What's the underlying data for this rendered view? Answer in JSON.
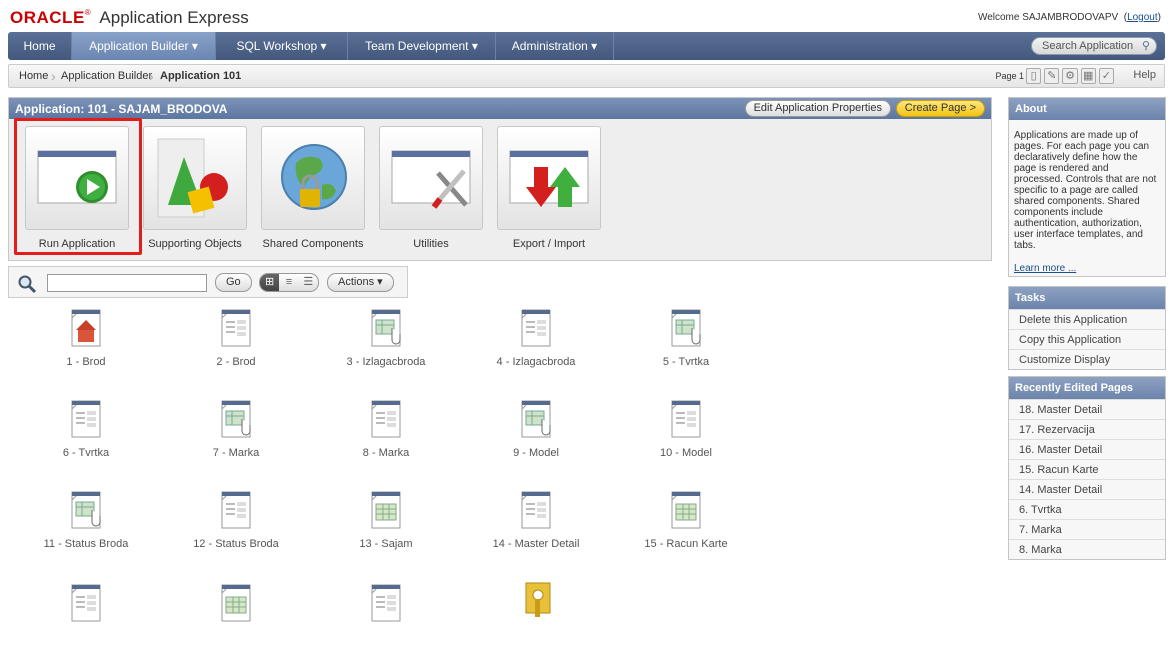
{
  "header": {
    "brand": "ORACLE",
    "brand_mark": "®",
    "product": "Application Express",
    "welcome": "Welcome SAJAMBRODOVAPV",
    "logout": "Logout"
  },
  "nav": {
    "tabs": [
      {
        "label": "Home",
        "has_menu": false
      },
      {
        "label": "Application Builder ▾",
        "has_menu": true
      },
      {
        "label": "SQL Workshop ▾",
        "has_menu": true
      },
      {
        "label": "Team Development ▾",
        "has_menu": true
      },
      {
        "label": "Administration ▾",
        "has_menu": true
      }
    ],
    "active_tab": "Application Builder",
    "search_placeholder": "Search Application"
  },
  "breadcrumb": {
    "items": [
      "Home",
      "Application Builder",
      "Application 101"
    ],
    "page_label": "Page 1",
    "help": "Help"
  },
  "application": {
    "title": "Application: 101 - SAJAM_BRODOVA",
    "edit_button": "Edit Application Properties",
    "create_button": "Create Page >",
    "launchers": [
      {
        "label": "Run Application",
        "icon": "run-icon"
      },
      {
        "label": "Supporting Objects",
        "icon": "shapes-icon"
      },
      {
        "label": "Shared Components",
        "icon": "globe-icon"
      },
      {
        "label": "Utilities",
        "icon": "tools-icon"
      },
      {
        "label": "Export / Import",
        "icon": "arrows-icon"
      }
    ]
  },
  "toolbar": {
    "go": "Go",
    "actions": "Actions ▾",
    "view_icons": [
      "⊞",
      "≡",
      "☰"
    ]
  },
  "pages": [
    {
      "label": "1 - Brod",
      "icon": "home-page-icon"
    },
    {
      "label": "2 - Brod",
      "icon": "form-page-icon"
    },
    {
      "label": "3 - Izlagacbroda",
      "icon": "report-page-icon"
    },
    {
      "label": "4 - Izlagacbroda",
      "icon": "form-page-icon"
    },
    {
      "label": "5 - Tvrtka",
      "icon": "report-page-icon"
    },
    {
      "label": "6 - Tvrtka",
      "icon": "form-page-icon"
    },
    {
      "label": "7 - Marka",
      "icon": "report-page-icon"
    },
    {
      "label": "8 - Marka",
      "icon": "form-page-icon"
    },
    {
      "label": "9 - Model",
      "icon": "report-page-icon"
    },
    {
      "label": "10 - Model",
      "icon": "form-page-icon"
    },
    {
      "label": "11 - Status Broda",
      "icon": "report-page-icon"
    },
    {
      "label": "12 - Status Broda",
      "icon": "form-page-icon"
    },
    {
      "label": "13 - Sajam",
      "icon": "table-page-icon"
    },
    {
      "label": "14 - Master Detail",
      "icon": "form-page-icon"
    },
    {
      "label": "15 - Racun Karte",
      "icon": "table-page-icon"
    },
    {
      "label": "",
      "icon": "form-page-icon"
    },
    {
      "label": "",
      "icon": "table-page-icon"
    },
    {
      "label": "",
      "icon": "form-page-icon"
    },
    {
      "label": "",
      "icon": "key-page-icon"
    }
  ],
  "about": {
    "title": "About",
    "text": "Applications are made up of pages. For each page you can declaratively define how the page is rendered and processed. Controls that are not specific to a page are called shared components. Shared components include authentication, authorization, user interface templates, and tabs.",
    "learn_more": "Learn more ..."
  },
  "tasks": {
    "title": "Tasks",
    "items": [
      "Delete this Application",
      "Copy this Application",
      "Customize Display"
    ]
  },
  "recent": {
    "title": "Recently Edited Pages",
    "items": [
      "18. Master Detail",
      "17. Rezervacija",
      "16. Master Detail",
      "15. Racun Karte",
      "14. Master Detail",
      "6. Tvrtka",
      "7. Marka",
      "8. Marka"
    ]
  },
  "colors": {
    "brand_red": "#cc0000",
    "nav_blue": "#43587c",
    "highlight_red": "#e31c1c",
    "create_yellow": "#f3c311"
  }
}
